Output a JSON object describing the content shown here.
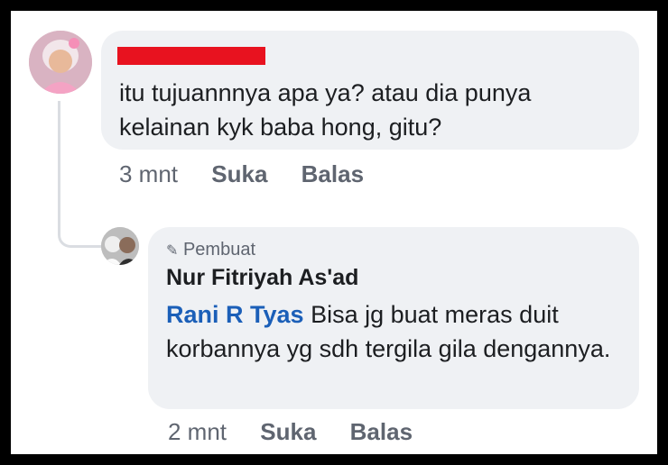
{
  "comment1": {
    "text": "itu tujuannnya apa ya? atau dia punya kelainan kyk baba hong, gitu?",
    "time": "3 mnt",
    "like": "Suka",
    "reply": "Balas"
  },
  "comment2": {
    "badge": "Pembuat",
    "author": "Nur Fitriyah As'ad",
    "mention": "Rani R Tyas",
    "text": "Bisa jg buat meras duit korbannya yg sdh tergila gila dengannya.",
    "time": "2 mnt",
    "like": "Suka",
    "reply": "Balas"
  },
  "colors": {
    "bubble": "#eff1f4",
    "mention": "#1b5fb8",
    "redaction": "#e8121f",
    "meta": "#5f6570"
  }
}
